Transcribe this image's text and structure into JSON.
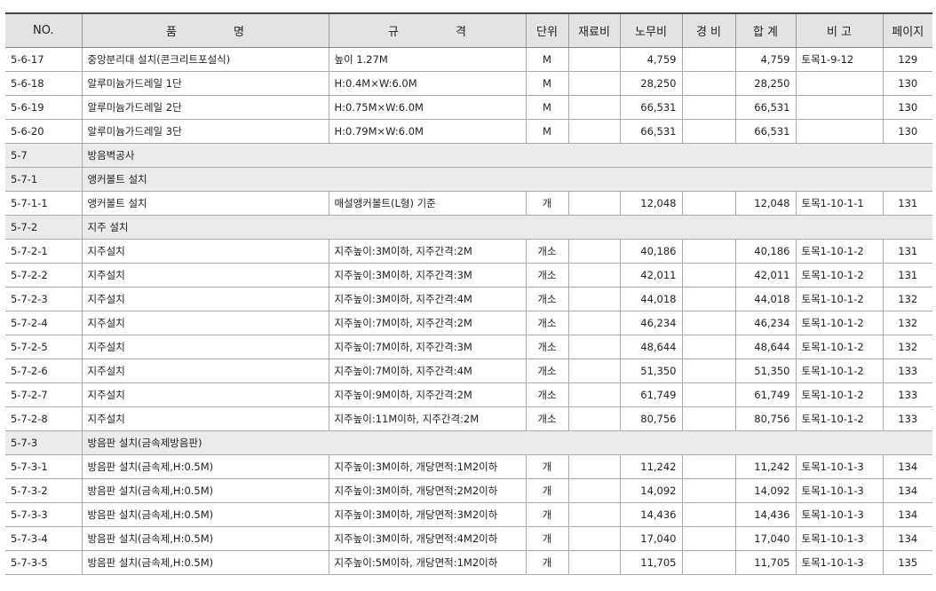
{
  "headers": {
    "no": "NO.",
    "name": "품 명",
    "spec": "규 격",
    "unit": "단위",
    "material": "재료비",
    "labor": "노무비",
    "expense": "경 비",
    "total": "합 계",
    "remarks": "비 고",
    "page": "페이지"
  },
  "rows": [
    {
      "no": "5-6-17",
      "name": "중앙분리대 설치(콘크리트포설식)",
      "spec": "높이 1.27M",
      "unit": "M",
      "material": "",
      "labor": "4,759",
      "expense": "",
      "total": "4,759",
      "remarks": "토목1-9-12",
      "page": "129"
    },
    {
      "no": "5-6-18",
      "name": "알루미늄가드레일 1단",
      "spec": "H:0.4M×W:6.0M",
      "unit": "M",
      "material": "",
      "labor": "28,250",
      "expense": "",
      "total": "28,250",
      "remarks": "",
      "page": "130"
    },
    {
      "no": "5-6-19",
      "name": "알루미늄가드레일 2단",
      "spec": "H:0.75M×W:6.0M",
      "unit": "M",
      "material": "",
      "labor": "66,531",
      "expense": "",
      "total": "66,531",
      "remarks": "",
      "page": "130"
    },
    {
      "no": "5-6-20",
      "name": "알루미늄가드레일 3단",
      "spec": "H:0.79M×W:6.0M",
      "unit": "M",
      "material": "",
      "labor": "66,531",
      "expense": "",
      "total": "66,531",
      "remarks": "",
      "page": "130"
    },
    {
      "section": true,
      "no": "5-7",
      "name": "방음벽공사"
    },
    {
      "section": true,
      "no": "5-7-1",
      "name": "앵커볼트 설치"
    },
    {
      "no": "5-7-1-1",
      "name": "앵커볼트 설치",
      "spec": "매설앵커볼트(L형) 기준",
      "unit": "개",
      "material": "",
      "labor": "12,048",
      "expense": "",
      "total": "12,048",
      "remarks": "토목1-10-1-1",
      "page": "131"
    },
    {
      "section": true,
      "no": "5-7-2",
      "name": "지주 설치"
    },
    {
      "no": "5-7-2-1",
      "name": "지주설치",
      "spec": "지주높이:3M이하, 지주간격:2M",
      "unit": "개소",
      "material": "",
      "labor": "40,186",
      "expense": "",
      "total": "40,186",
      "remarks": "토목1-10-1-2",
      "page": "131"
    },
    {
      "no": "5-7-2-2",
      "name": "지주설치",
      "spec": "지주높이:3M이하, 지주간격:3M",
      "unit": "개소",
      "material": "",
      "labor": "42,011",
      "expense": "",
      "total": "42,011",
      "remarks": "토목1-10-1-2",
      "page": "131"
    },
    {
      "no": "5-7-2-3",
      "name": "지주설치",
      "spec": "지주높이:3M이하, 지주간격:4M",
      "unit": "개소",
      "material": "",
      "labor": "44,018",
      "expense": "",
      "total": "44,018",
      "remarks": "토목1-10-1-2",
      "page": "132"
    },
    {
      "no": "5-7-2-4",
      "name": "지주설치",
      "spec": "지주높이:7M이하, 지주간격:2M",
      "unit": "개소",
      "material": "",
      "labor": "46,234",
      "expense": "",
      "total": "46,234",
      "remarks": "토목1-10-1-2",
      "page": "132"
    },
    {
      "no": "5-7-2-5",
      "name": "지주설치",
      "spec": "지주높이:7M이하, 지주간격:3M",
      "unit": "개소",
      "material": "",
      "labor": "48,644",
      "expense": "",
      "total": "48,644",
      "remarks": "토목1-10-1-2",
      "page": "132"
    },
    {
      "no": "5-7-2-6",
      "name": "지주설치",
      "spec": "지주높이:7M이하, 지주간격:4M",
      "unit": "개소",
      "material": "",
      "labor": "51,350",
      "expense": "",
      "total": "51,350",
      "remarks": "토목1-10-1-2",
      "page": "133"
    },
    {
      "no": "5-7-2-7",
      "name": "지주설치",
      "spec": "지주높이:9M이하, 지주간격:2M",
      "unit": "개소",
      "material": "",
      "labor": "61,749",
      "expense": "",
      "total": "61,749",
      "remarks": "토목1-10-1-2",
      "page": "133"
    },
    {
      "no": "5-7-2-8",
      "name": "지주설치",
      "spec": "지주높이:11M이하, 지주간격:2M",
      "unit": "개소",
      "material": "",
      "labor": "80,756",
      "expense": "",
      "total": "80,756",
      "remarks": "토목1-10-1-2",
      "page": "133"
    },
    {
      "section": true,
      "no": "5-7-3",
      "name": "방음판 설치(금속제방음판)"
    },
    {
      "no": "5-7-3-1",
      "name": "방음판 설치(금속제,H:0.5M)",
      "spec": "지주높이:3M이하, 개당면적:1M2이하",
      "unit": "개",
      "material": "",
      "labor": "11,242",
      "expense": "",
      "total": "11,242",
      "remarks": "토목1-10-1-3",
      "page": "134"
    },
    {
      "no": "5-7-3-2",
      "name": "방음판 설치(금속제,H:0.5M)",
      "spec": "지주높이:3M이하, 개당면적:2M2이하",
      "unit": "개",
      "material": "",
      "labor": "14,092",
      "expense": "",
      "total": "14,092",
      "remarks": "토목1-10-1-3",
      "page": "134"
    },
    {
      "no": "5-7-3-3",
      "name": "방음판 설치(금속제,H:0.5M)",
      "spec": "지주높이:3M이하, 개당면적:3M2이하",
      "unit": "개",
      "material": "",
      "labor": "14,436",
      "expense": "",
      "total": "14,436",
      "remarks": "토목1-10-1-3",
      "page": "134"
    },
    {
      "no": "5-7-3-4",
      "name": "방음판 설치(금속제,H:0.5M)",
      "spec": "지주높이:3M이하, 개당면적:4M2이하",
      "unit": "개",
      "material": "",
      "labor": "17,040",
      "expense": "",
      "total": "17,040",
      "remarks": "토목1-10-1-3",
      "page": "134"
    },
    {
      "no": "5-7-3-5",
      "name": "방음판 설치(금속제,H:0.5M)",
      "spec": "지주높이:5M이하, 개당면적:1M2이하",
      "unit": "개",
      "material": "",
      "labor": "11,705",
      "expense": "",
      "total": "11,705",
      "remarks": "토목1-10-1-3",
      "page": "135"
    }
  ]
}
